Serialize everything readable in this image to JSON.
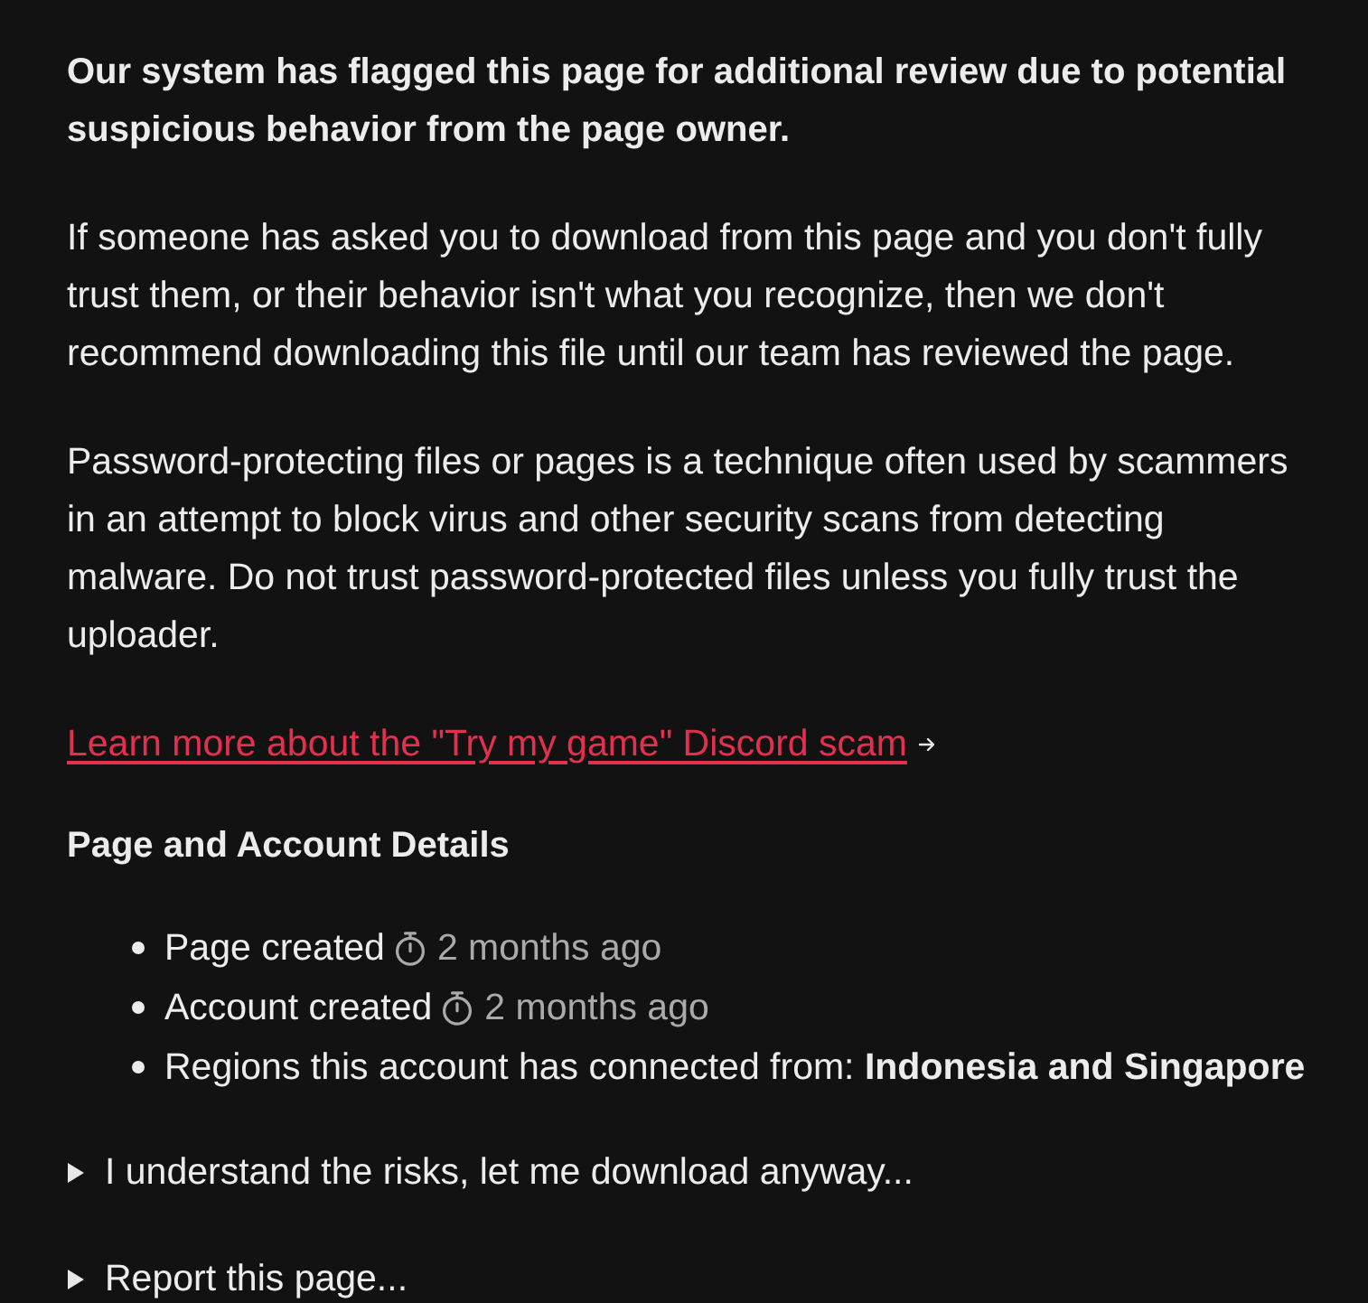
{
  "paragraphs": [
    {
      "text": "Our system has flagged this page for additional review due to potential suspicious behavior from the page owner.",
      "bold": true
    },
    {
      "text": "If someone has asked you to download from this page and you don't fully trust them, or their behavior isn't what you recognize, then we don't recommend downloading this file until our team has reviewed the page.",
      "bold": false
    },
    {
      "text": "Password-protecting files or pages is a technique often used by scammers in an attempt to block virus and other security scans from detecting malware. Do not trust password-protected files unless you fully trust the uploader.",
      "bold": false
    }
  ],
  "link": {
    "label": "Learn more about the \"Try my game\" Discord scam"
  },
  "details": {
    "heading": "Page and Account Details",
    "items": [
      {
        "kind": "timed",
        "label": "Page created",
        "time": "2 months ago"
      },
      {
        "kind": "timed",
        "label": "Account created",
        "time": "2 months ago"
      },
      {
        "kind": "text",
        "text": "Regions this account has connected from: **Indonesia and Singapore**"
      }
    ]
  },
  "disclosures": [
    {
      "label": "I understand the risks, let me download anyway...",
      "expanded": false
    },
    {
      "label": "Report this page...",
      "expanded": false
    }
  ]
}
